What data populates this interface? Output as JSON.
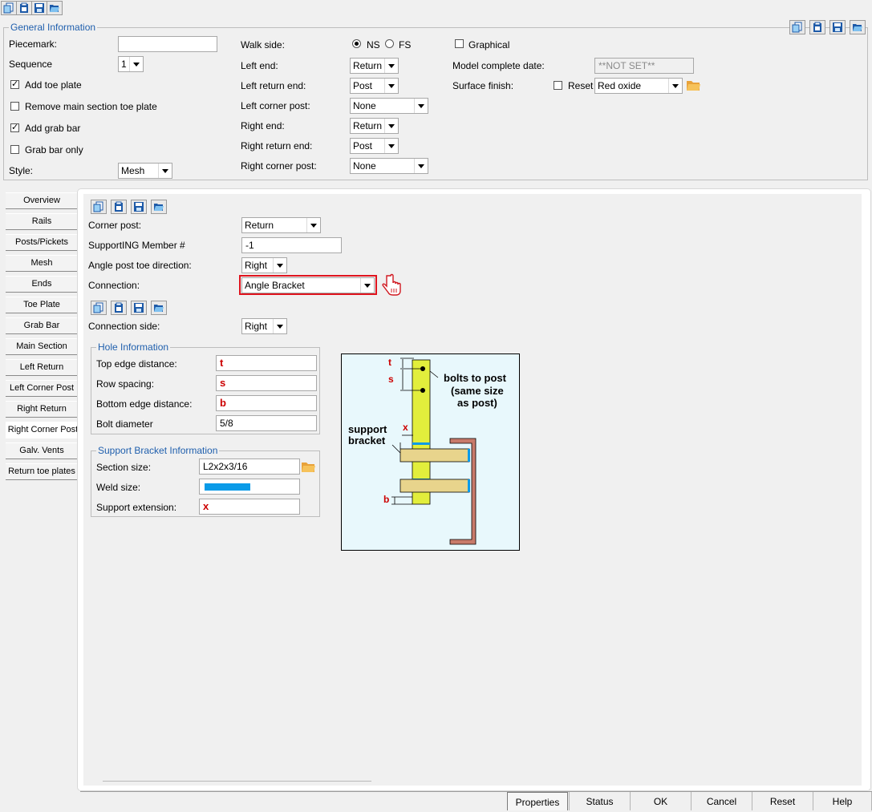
{
  "general": {
    "title": "General Information",
    "piecemark_label": "Piecemark:",
    "piecemark_value": "",
    "sequence_label": "Sequence",
    "sequence_value": "1",
    "add_toe_plate": "Add toe plate",
    "remove_main_toe_plate": "Remove main section toe plate",
    "add_grab_bar": "Add grab bar",
    "grab_bar_only": "Grab bar only",
    "style_label": "Style:",
    "style_value": "Mesh",
    "walk_side_label": "Walk side:",
    "walk_ns": "NS",
    "walk_fs": "FS",
    "left_end_label": "Left end:",
    "left_end_value": "Return",
    "left_return_end_label": "Left return end:",
    "left_return_end_value": "Post",
    "left_corner_post_label": "Left corner post:",
    "left_corner_post_value": "None",
    "right_end_label": "Right end:",
    "right_end_value": "Return",
    "right_return_end_label": "Right return end:",
    "right_return_end_value": "Post",
    "right_corner_post_label": "Right corner post:",
    "right_corner_post_value": "None",
    "graphical_label": "Graphical",
    "model_complete_label": "Model complete date:",
    "model_complete_value": "**NOT SET**",
    "surface_finish_label": "Surface finish:",
    "reset_label": "Reset",
    "surface_finish_value": "Red oxide"
  },
  "tabs": [
    "Overview",
    "Rails",
    "Posts/Pickets",
    "Mesh",
    "Ends",
    "Toe Plate",
    "Grab Bar",
    "Main Section",
    "Left Return",
    "Left Corner Post",
    "Right Return",
    "Right Corner Post",
    "Galv. Vents",
    "Return toe plates"
  ],
  "active_tab": "Right Corner Post",
  "panel": {
    "corner_post_label": "Corner post:",
    "corner_post_value": "Return",
    "supporting_member_label": "SupportING Member #",
    "supporting_member_value": "-1",
    "angle_toe_label": "Angle post toe direction:",
    "angle_toe_value": "Right",
    "connection_label": "Connection:",
    "connection_value": "Angle Bracket",
    "connection_side_label": "Connection side:",
    "connection_side_value": "Right"
  },
  "hole_info": {
    "title": "Hole Information",
    "top_edge_label": "Top edge distance:",
    "top_edge_value": "t",
    "row_spacing_label": "Row spacing:",
    "row_spacing_value": "s",
    "bottom_edge_label": "Bottom edge distance:",
    "bottom_edge_value": "b",
    "bolt_diameter_label": "Bolt diameter",
    "bolt_diameter_value": "5/8"
  },
  "support_info": {
    "title": "Support Bracket Information",
    "section_size_label": "Section size:",
    "section_size_value": "L2x2x3/16",
    "weld_size_label": "Weld size:",
    "weld_color": "#0a9be8",
    "support_extension_label": "Support extension:",
    "support_extension_value": "x"
  },
  "diagram": {
    "t": "t",
    "s": "s",
    "x": "x",
    "b": "b",
    "bolts_line1": "bolts to post",
    "bolts_line2": "(same size",
    "bolts_line3": "as post)",
    "support_line1": "support",
    "support_line2": "bracket"
  },
  "buttons": {
    "properties": "Properties",
    "status": "Status",
    "ok": "OK",
    "cancel": "Cancel",
    "reset": "Reset",
    "help": "Help"
  },
  "colors": {
    "accent_blue": "#1f5fad",
    "highlight_red": "#e0141e",
    "post_yellow": "#e2ee3c",
    "bracket_tan": "#e8d48c",
    "channel_brown": "#c87a6a",
    "diagram_bg": "#e8f8fc"
  }
}
